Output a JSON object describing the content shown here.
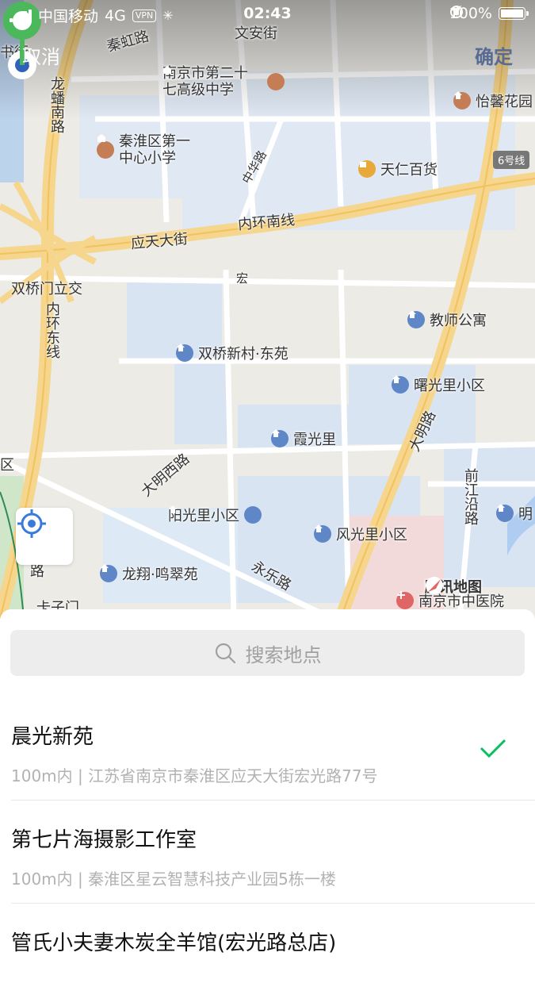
{
  "status_bar": {
    "carrier": "中国移动",
    "network": "4G",
    "vpn": "VPN",
    "time": "02:43",
    "battery": "100%"
  },
  "nav": {
    "cancel": "取消",
    "confirm": "确定"
  },
  "map": {
    "road_labels": [
      "秦虹路",
      "文安街",
      "龙蟠南路",
      "中华路",
      "应天大街",
      "内环南线",
      "双桥门立交",
      "内环东线",
      "大明西路",
      "大明路",
      "前江沿路",
      "永乐路",
      "卡子门",
      "宏",
      "区",
      "书街",
      "路"
    ],
    "pois": {
      "school1": "南京市第二十七高级中学",
      "school2": "秦淮区第一中心小学",
      "store": "天仁百货",
      "garden": "怡馨花园",
      "metro": "6号线",
      "dongyuan": "双桥新村·东苑",
      "teacher": "教师公寓",
      "shuguang": "曙光里小区",
      "xiaguang": "霞光里",
      "yangguang": "阳光里小区",
      "fengguang": "风光里小区",
      "longxiang": "龙翔·鸣翠苑",
      "hospital": "南京市中医院",
      "ming": "明"
    },
    "watermark": "腾讯地图"
  },
  "search": {
    "placeholder": "搜索地点"
  },
  "results": [
    {
      "name": "晨光新苑",
      "address": "100m内 | 江苏省南京市秦淮区应天大街宏光路77号",
      "selected": true
    },
    {
      "name": "第七片海摄影工作室",
      "address": "100m内 | 秦淮区星云智慧科技产业园5栋一楼",
      "selected": false
    },
    {
      "name": "管氏小夫妻木炭全羊馆(宏光路总店)",
      "address": "",
      "selected": false
    }
  ],
  "colors": {
    "accent_green": "#07c160",
    "confirm_blue": "#576b95",
    "pin_green": "#4cb85c"
  }
}
